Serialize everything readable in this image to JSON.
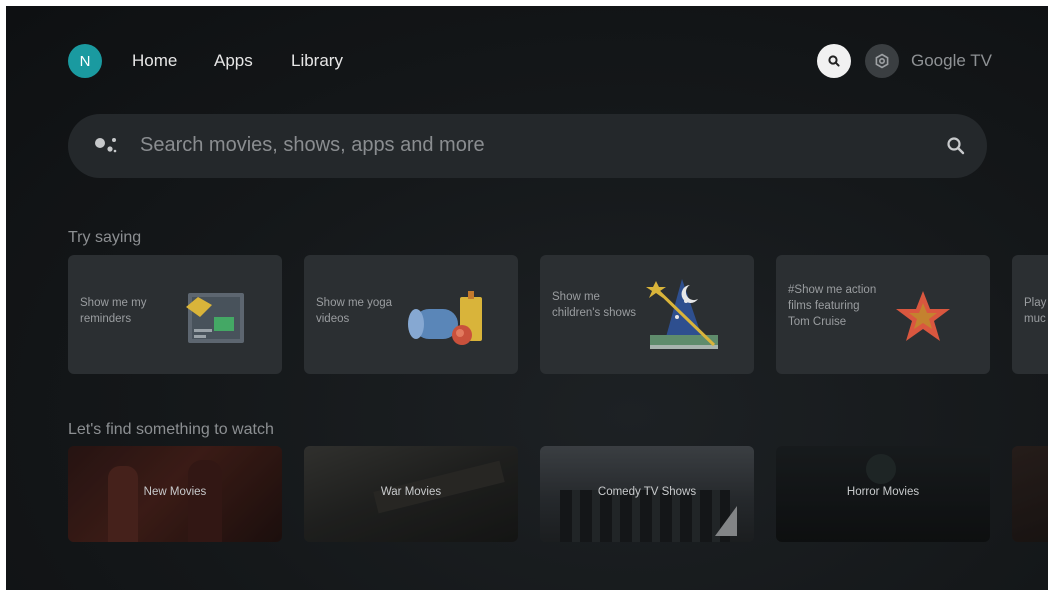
{
  "nav": {
    "avatar_initial": "N",
    "items": [
      "Home",
      "Apps",
      "Library"
    ],
    "brand": "Google TV",
    "accent": "#1a9aa0"
  },
  "search": {
    "placeholder": "Search movies, shows, apps and more",
    "assistant_icon": "google-assistant-icon",
    "search_icon": "search-icon"
  },
  "try_saying": {
    "title": "Try saying",
    "cards": [
      {
        "text": "Show me my reminders",
        "icon": "reminders-illustration"
      },
      {
        "text": "Show me yoga videos",
        "icon": "yoga-illustration"
      },
      {
        "text": "Show me children's shows",
        "icon": "wizard-illustration"
      },
      {
        "text": "#Show me action films featuring Tom Cruise",
        "icon": "star-illustration"
      },
      {
        "text": "Play muc",
        "icon": "music-illustration"
      }
    ]
  },
  "watch": {
    "title": "Let's find something to watch",
    "tiles": [
      "New Movies",
      "War Movies",
      "Comedy TV Shows",
      "Horror Movies"
    ]
  }
}
